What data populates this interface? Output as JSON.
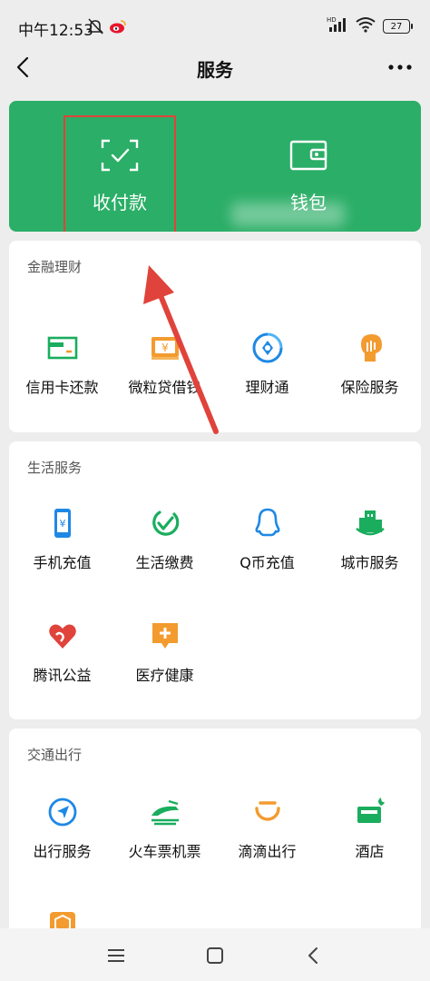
{
  "status_bar": {
    "time": "中午12:53",
    "network": "HD",
    "battery": "27"
  },
  "navbar": {
    "title": "服务"
  },
  "hero": {
    "pay": "收付款",
    "wallet": "钱包"
  },
  "sections": [
    {
      "title": "金融理财",
      "items": [
        {
          "label": "信用卡还款",
          "icon": "credit-card-icon"
        },
        {
          "label": "微粒贷借钱",
          "icon": "loan-icon"
        },
        {
          "label": "理财通",
          "icon": "wealth-icon"
        },
        {
          "label": "保险服务",
          "icon": "insurance-icon"
        }
      ]
    },
    {
      "title": "生活服务",
      "items": [
        {
          "label": "手机充值",
          "icon": "phone-topup-icon"
        },
        {
          "label": "生活缴费",
          "icon": "utility-bill-icon"
        },
        {
          "label": "Q币充值",
          "icon": "qcoin-icon"
        },
        {
          "label": "城市服务",
          "icon": "city-service-icon"
        },
        {
          "label": "腾讯公益",
          "icon": "charity-icon"
        },
        {
          "label": "医疗健康",
          "icon": "medical-icon"
        }
      ]
    },
    {
      "title": "交通出行",
      "items": [
        {
          "label": "出行服务",
          "icon": "travel-icon"
        },
        {
          "label": "火车票机票",
          "icon": "train-ticket-icon"
        },
        {
          "label": "滴滴出行",
          "icon": "didi-icon"
        },
        {
          "label": "酒店",
          "icon": "hotel-icon"
        }
      ]
    }
  ],
  "colors": {
    "hero_green": "#2bae67",
    "accent_green": "#1aad5d",
    "orange": "#f39b2f",
    "blue": "#1e88e5",
    "red": "#e0433b"
  }
}
